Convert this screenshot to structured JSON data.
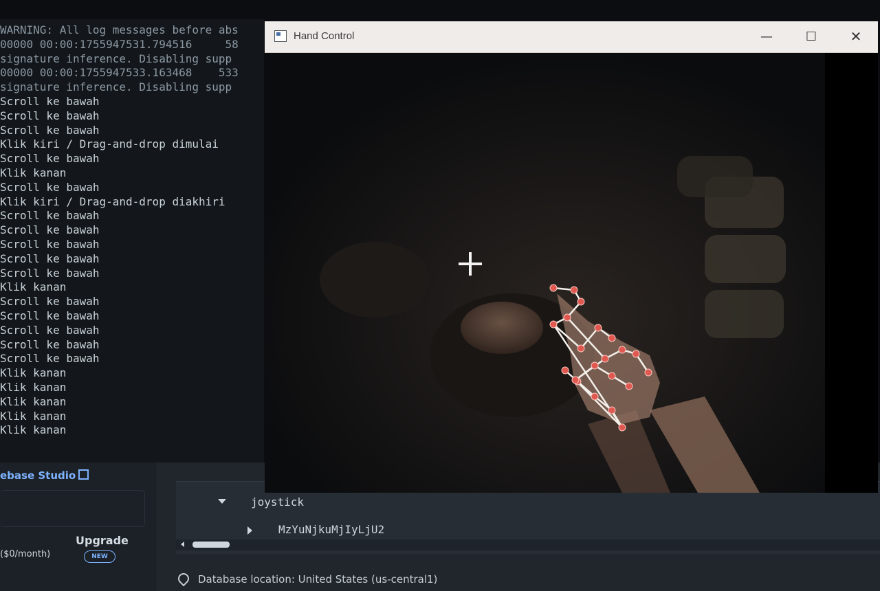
{
  "terminal": {
    "lines": [
      "WARNING: All log messages before abs",
      "00000 00:00:1755947531.794516     58",
      "signature inference. Disabling supp",
      "00000 00:00:1755947533.163468    533",
      "signature inference. Disabling supp",
      "Scroll ke bawah",
      "Scroll ke bawah",
      "Scroll ke bawah",
      "Klik kiri / Drag-and-drop dimulai",
      "Scroll ke bawah",
      "Klik kanan",
      "Scroll ke bawah",
      "Klik kiri / Drag-and-drop diakhiri",
      "Scroll ke bawah",
      "Scroll ke bawah",
      "Scroll ke bawah",
      "Scroll ke bawah",
      "Scroll ke bawah",
      "Klik kanan",
      "Scroll ke bawah",
      "Scroll ke bawah",
      "Scroll ke bawah",
      "Scroll ke bawah",
      "Scroll ke bawah",
      "Klik kanan",
      "Klik kanan",
      "Klik kanan",
      "Klik kanan",
      "Klik kanan"
    ]
  },
  "hand_window": {
    "title": "Hand Control",
    "minimize_glyph": "—",
    "maximize_glyph": "☐",
    "close_glyph": "✕"
  },
  "console": {
    "studio_link": "ebase Studio",
    "upgrade_label": "Upgrade",
    "plan_text": "($0/month)",
    "new_badge": "NEW",
    "tree": {
      "node_expanded": "joystick",
      "node_child": "MzYuNjkuMjIyLjU2"
    },
    "location": "Database location: United States (us-central1)"
  },
  "icons": {
    "app": "window-app-icon",
    "external": "external-link-icon",
    "pin": "location-pin-icon",
    "crosshair": "cursor-crosshair-icon"
  },
  "colors": {
    "landmark": "#e0584f",
    "connection": "#f3efe9",
    "link": "#7fb3ff"
  }
}
